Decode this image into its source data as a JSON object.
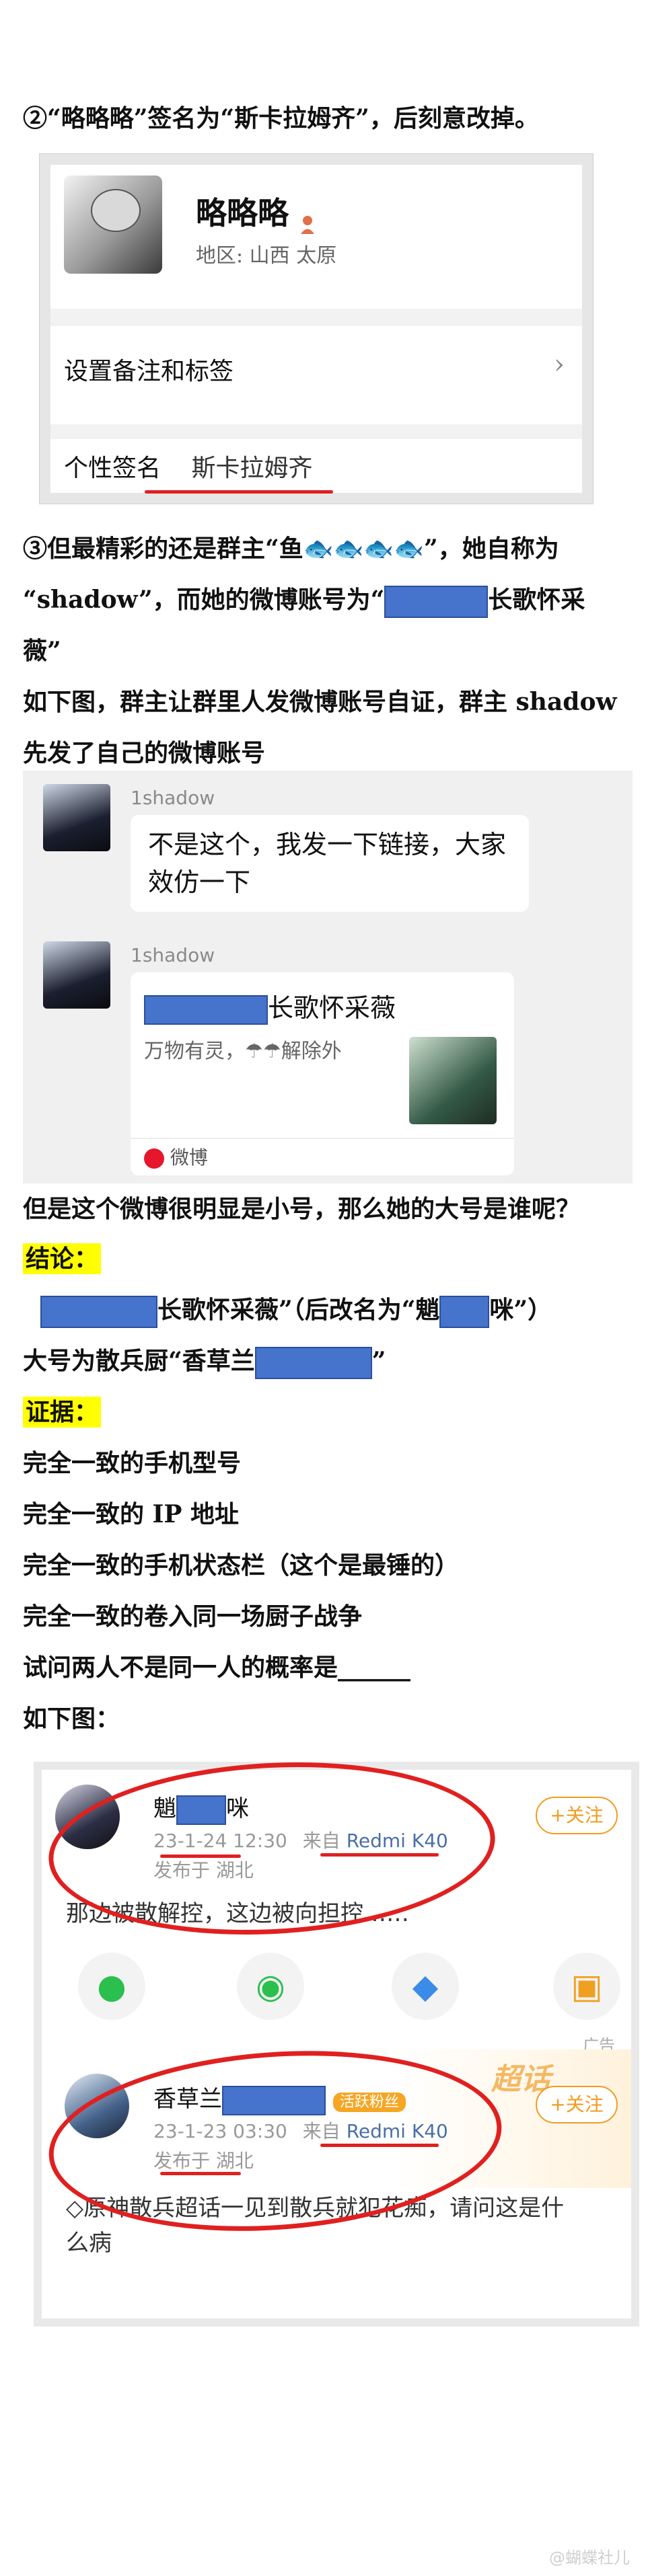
{
  "paragraphs": {
    "p2": "②“略略略”签名为“斯卡拉姆齐”，后刻意改掉。",
    "p3a": "③但最精彩的还是群主“鱼🐟🐟🐟🐟”，她自称为",
    "p3b_pre": "“shadow”，而她的微博账号为“",
    "p3b_post": "长歌怀采",
    "p3c": "薇”",
    "p4a": "如下图，群主让群里人发微博账号自证，群主 shadow",
    "p4b": "先发了自己的微博账号",
    "q1": "但是这个微博很明显是小号，那么她的大号是谁呢？",
    "conclusion_label": "结论：",
    "c1_post": "长歌怀采薇”（后改名为“魈",
    "c1_end": "咪”）",
    "c2_pre": "大号为散兵厨“香草兰",
    "c2_end": "”",
    "evidence_label": "证据：",
    "e1": "完全一致的手机型号",
    "e2": "完全一致的 IP 地址",
    "e3": "完全一致的手机状态栏（这个是最锤的）",
    "e4": "完全一致的卷入同一场厨子战争",
    "e5": "试问两人不是同一人的概率是______",
    "e6": "如下图："
  },
  "profile_card": {
    "username": "略略略",
    "region_label": "地区:",
    "region_value": "山西  太原",
    "remark_label": "设置备注和标签",
    "signature_label": "个性签名",
    "signature_value": "斯卡拉姆齐"
  },
  "chat": {
    "msg1_nick": "1shadow",
    "msg1_text_1": "不是这个，我发一下链接，大家",
    "msg1_text_2": "效仿一下",
    "msg2_nick": "1shadow",
    "msg2_title": "长歌怀采薇",
    "msg2_sub": "万物有灵，☂☂解除外",
    "msg2_source": "微博"
  },
  "weibo_posts": {
    "post1_name": "魈",
    "post1_name_end": "咪",
    "post1_time": "23-1-24 12:30",
    "post1_from": "来自",
    "post1_device": "Redmi K40",
    "post1_location": "发布于 湖北",
    "post1_text": "那边被散解控，这边被向担控……",
    "follow_label": "+关注",
    "ad_label": "广告",
    "post2_name": "香草兰",
    "post2_badge": "活跃粉丝",
    "post2_time": "23-1-23 03:30",
    "post2_from": "来自",
    "post2_device": "Redmi K40",
    "post2_location": "发布于 湖北",
    "post2_text_1": "◇原神散兵超话一见到散兵就犯花痴，请问这是什",
    "post2_text_2": "么病",
    "super_label": "超话"
  },
  "watermark": "@蝴蝶社儿"
}
